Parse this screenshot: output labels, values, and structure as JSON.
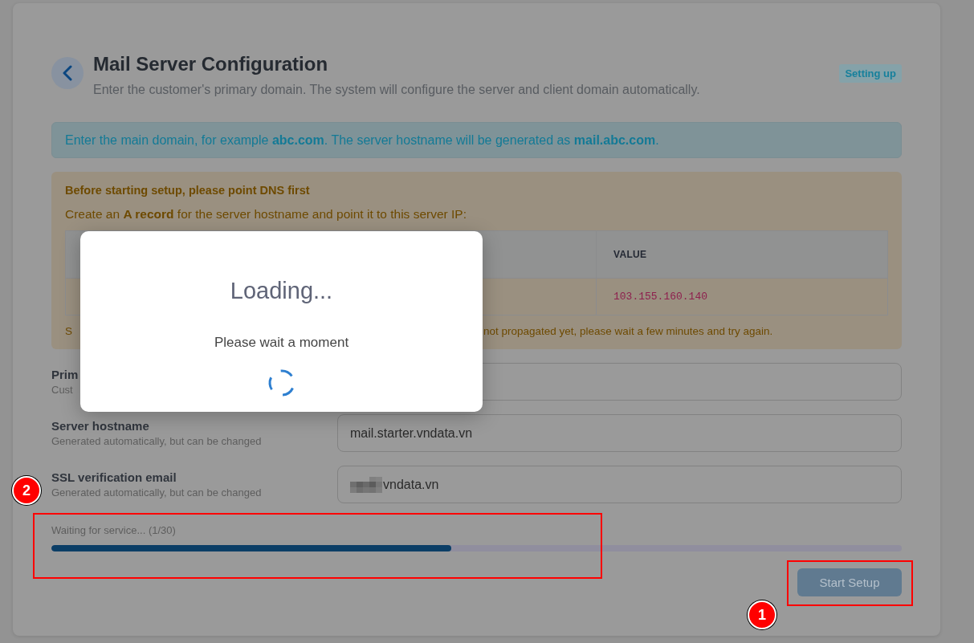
{
  "header": {
    "title": "Mail Server Configuration",
    "subtitle": "Enter the customer's primary domain. The system will configure the server and client domain automatically.",
    "status_badge": "Setting up"
  },
  "info_alert": {
    "text": "Enter the main domain, for example **abc.com**. The server hostname will be generated as **mail.abc.com**."
  },
  "dns_notice": {
    "title": "Before starting setup, please point DNS first",
    "text": "Create an **A record** for the server hostname and point it to this server IP:",
    "table": {
      "column_2": "VALUE",
      "rows": [
        {
          "column_2": "103.155.160.140"
        }
      ]
    },
    "note_parts": [
      "S",
      "not propagated yet, please wait a few minutes and try again."
    ]
  },
  "fields": [
    {
      "label": "Prim",
      "hint": "Cust"
    },
    {
      "label": "Server hostname",
      "hint": "Generated automatically, but can be changed",
      "value": "mail.starter.vndata.vn"
    },
    {
      "label": "SSL verification email",
      "hint": "Generated automatically, but can be changed",
      "value": "vndata.vn",
      "redacted": true
    }
  ],
  "progress": {
    "status": "Waiting for service... (1/30)",
    "level": 0.47,
    "highlighted": true
  },
  "start_button": {
    "label": "Start Setup",
    "disabled": true,
    "highlighted": true
  },
  "modal": {
    "title": "Loading...",
    "message": "Please wait a moment"
  },
  "annotations": [
    {
      "label": "2"
    },
    {
      "label": "1"
    }
  ]
}
